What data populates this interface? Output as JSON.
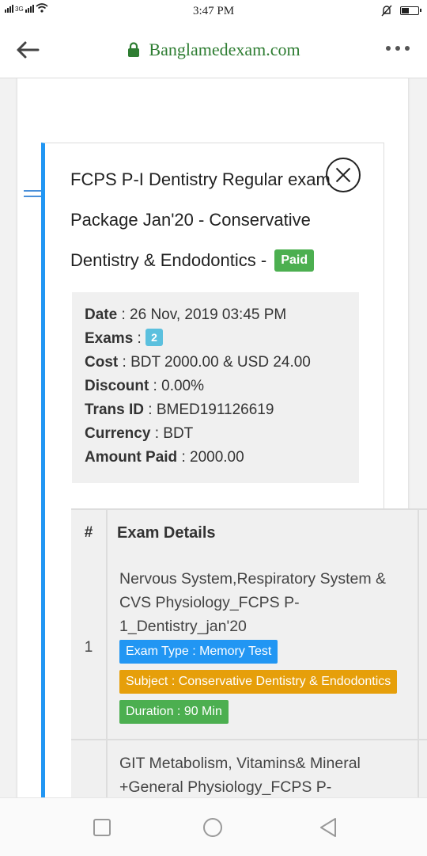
{
  "status": {
    "network": "3G",
    "time": "3:47 PM"
  },
  "browser": {
    "url": "Banglamedexam.com"
  },
  "order": {
    "title": "FCPS P-I Dentistry Regular exam Package Jan'20 - Conservative Dentistry & Endodontics -",
    "status_badge": "Paid",
    "details": [
      {
        "label": "Date",
        "value": "26 Nov, 2019 03:45 PM"
      },
      {
        "label": "Exams",
        "badge": "2"
      },
      {
        "label": "Cost",
        "value": "BDT 2000.00 & USD 24.00"
      },
      {
        "label": "Discount",
        "value": "0.00%"
      },
      {
        "label": "Trans ID",
        "value": "BMED191126619"
      },
      {
        "label": "Currency",
        "value": "BDT"
      },
      {
        "label": "Amount Paid",
        "value": "2000.00"
      }
    ]
  },
  "table": {
    "headers": [
      "#",
      "Exam Details"
    ],
    "rows": [
      {
        "num": "1",
        "name": "Nervous System,Respiratory System & CVS Physiology_FCPS P-1_Dentistry_jan'20",
        "exam_type": "Exam Type : Memory Test",
        "subject": "Subject : Conservative Dentistry & Endodontics",
        "duration": "Duration : 90 Min"
      },
      {
        "num": "",
        "name": "GIT Metabolism, Vitamins& Mineral +General Physiology_FCPS P-"
      }
    ]
  },
  "colors": {
    "accent": "#2196f3",
    "paid": "#4caf50",
    "subject_tag": "#e69f0a",
    "url": "#2e7d32"
  }
}
